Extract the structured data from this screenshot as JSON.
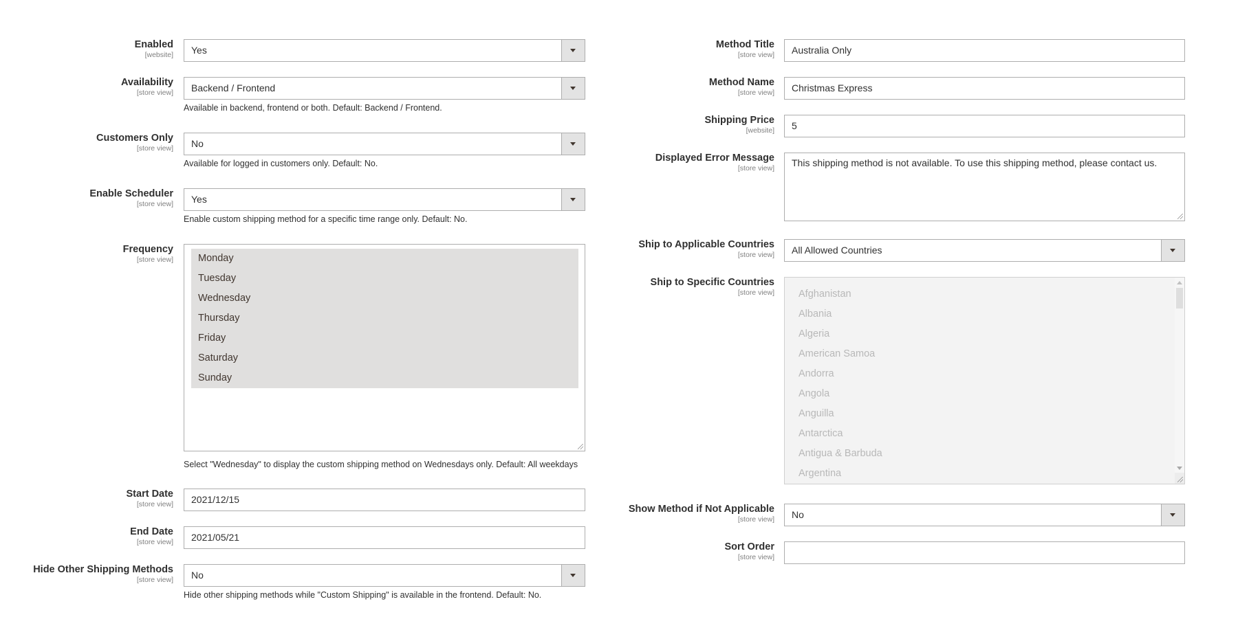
{
  "left": {
    "enabled": {
      "label": "Enabled",
      "scope": "[website]",
      "value": "Yes"
    },
    "availability": {
      "label": "Availability",
      "scope": "[store view]",
      "value": "Backend / Frontend",
      "note": "Available in backend, frontend or both. Default: Backend / Frontend."
    },
    "customers_only": {
      "label": "Customers Only",
      "scope": "[store view]",
      "value": "No",
      "note": "Available for logged in customers only. Default: No."
    },
    "enable_scheduler": {
      "label": "Enable Scheduler",
      "scope": "[store view]",
      "value": "Yes",
      "note": "Enable custom shipping method for a specific time range only. Default: No."
    },
    "frequency": {
      "label": "Frequency",
      "scope": "[store view]",
      "options": [
        "Monday",
        "Tuesday",
        "Wednesday",
        "Thursday",
        "Friday",
        "Saturday",
        "Sunday"
      ],
      "note": "Select \"Wednesday\" to display the custom shipping method on Wednesdays only. Default: All weekdays"
    },
    "start_date": {
      "label": "Start Date",
      "scope": "[store view]",
      "value": "2021/12/15"
    },
    "end_date": {
      "label": "End Date",
      "scope": "[store view]",
      "value": "2021/05/21"
    },
    "hide_other": {
      "label": "Hide Other Shipping Methods",
      "scope": "[store view]",
      "value": "No",
      "note": "Hide other shipping methods while \"Custom Shipping\" is available in the frontend. Default: No."
    }
  },
  "right": {
    "method_title": {
      "label": "Method Title",
      "scope": "[store view]",
      "value": "Australia Only"
    },
    "method_name": {
      "label": "Method Name",
      "scope": "[store view]",
      "value": "Christmas Express"
    },
    "shipping_price": {
      "label": "Shipping Price",
      "scope": "[website]",
      "value": "5"
    },
    "error_message": {
      "label": "Displayed Error Message",
      "scope": "[store view]",
      "value": "This shipping method is not available. To use this shipping method, please contact us."
    },
    "applicable_countries": {
      "label": "Ship to Applicable Countries",
      "scope": "[store view]",
      "value": "All Allowed Countries"
    },
    "specific_countries": {
      "label": "Ship to Specific Countries",
      "scope": "[store view]",
      "options": [
        "Afghanistan",
        "Albania",
        "Algeria",
        "American Samoa",
        "Andorra",
        "Angola",
        "Anguilla",
        "Antarctica",
        "Antigua & Barbuda",
        "Argentina"
      ]
    },
    "show_method": {
      "label": "Show Method if Not Applicable",
      "scope": "[store view]",
      "value": "No"
    },
    "sort_order": {
      "label": "Sort Order",
      "scope": "[store view]",
      "value": ""
    }
  }
}
